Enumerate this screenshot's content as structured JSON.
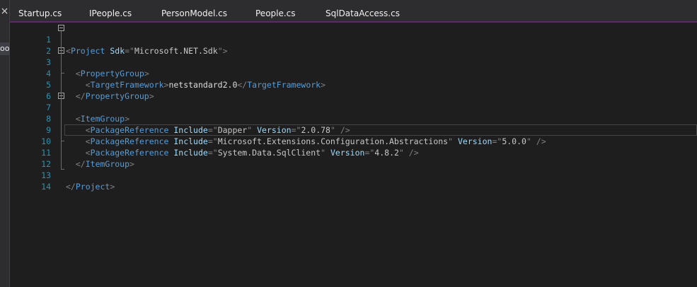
{
  "left_pane": {
    "close_glyph": "×",
    "label": "oo"
  },
  "tabs": [
    {
      "label": "Startup.cs"
    },
    {
      "label": "IPeople.cs"
    },
    {
      "label": "PersonModel.cs"
    },
    {
      "label": "People.cs"
    },
    {
      "label": "SqlDataAccess.cs"
    }
  ],
  "editor": {
    "current_line": 10,
    "line_numbers": [
      "1",
      "2",
      "3",
      "4",
      "5",
      "6",
      "7",
      "8",
      "9",
      "10",
      "11",
      "12",
      "13",
      "14"
    ],
    "lines": {
      "l1": {
        "open": "<",
        "tag": "Project",
        "attr1": "Sdk",
        "eq1": "=\"",
        "val1": "Microsoft.NET.Sdk",
        "close": "\">"
      },
      "l3": {
        "open": "<",
        "tag": "PropertyGroup",
        "close": ">"
      },
      "l4": {
        "open": "<",
        "tag": "TargetFramework",
        "mid": ">",
        "text": "netstandard2.0",
        "open2": "</",
        "tag2": "TargetFramework",
        "close": ">"
      },
      "l5": {
        "open": "</",
        "tag": "PropertyGroup",
        "close": ">"
      },
      "l7": {
        "open": "<",
        "tag": "ItemGroup",
        "close": ">"
      },
      "l8": {
        "open": "<",
        "tag": "PackageReference",
        "attr1": "Include",
        "eq1": "=\"",
        "val1": "Dapper",
        "q1": "\"",
        "attr2": "Version",
        "eq2": "=\"",
        "val2": "2.0.78",
        "close": "\" />"
      },
      "l9": {
        "open": "<",
        "tag": "PackageReference",
        "attr1": "Include",
        "eq1": "=\"",
        "val1": "Microsoft.Extensions.Configuration.Abstractions",
        "q1": "\"",
        "attr2": "Version",
        "eq2": "=\"",
        "val2": "5.0.0",
        "close": "\" />"
      },
      "l10": {
        "open": "<",
        "tag": "PackageReference",
        "attr1": "Include",
        "eq1": "=\"",
        "val1": "System.Data.SqlClient",
        "q1": "\"",
        "attr2": "Version",
        "eq2": "=\"",
        "val2": "4.8.2",
        "close": "\" />"
      },
      "l11": {
        "open": "</",
        "tag": "ItemGroup",
        "close": ">"
      },
      "l13": {
        "open": "</",
        "tag": "Project",
        "close": ">"
      }
    }
  }
}
